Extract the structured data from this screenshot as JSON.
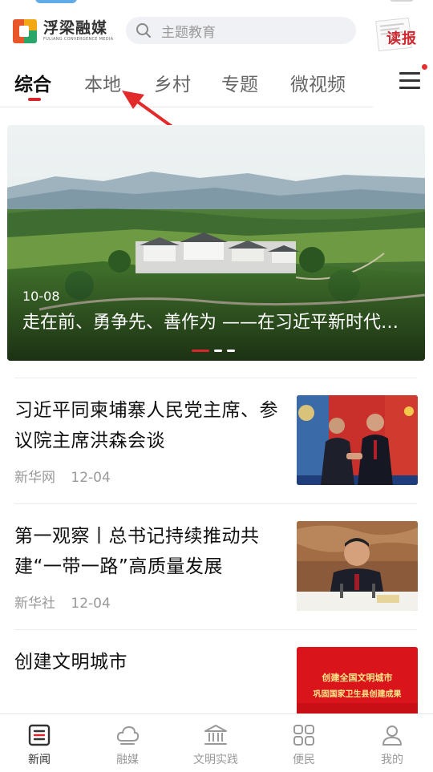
{
  "header": {
    "logo_cn": "浮梁融媒",
    "logo_en": "FULIANG CONVERGENCE MEDIA",
    "search_placeholder": "主题教育",
    "read_paper_label": "读报"
  },
  "tabs": [
    {
      "label": "综合",
      "active": true
    },
    {
      "label": "本地"
    },
    {
      "label": "乡村"
    },
    {
      "label": "专题"
    },
    {
      "label": "微视频"
    }
  ],
  "carousel": {
    "date": "10-08",
    "title": "走在前、勇争先、善作为 ——在习近平新时代中国特色社会主义思想指引下",
    "slide_count": 3,
    "active_slide": 1
  },
  "news": [
    {
      "title": "习近平同柬埔寨人民党主席、参议院主席洪森会谈",
      "source": "新华网",
      "date": "12-04"
    },
    {
      "title": "第一观察丨总书记持续推动共建“一带一路”高质量发展",
      "source": "新华社",
      "date": "12-04"
    },
    {
      "title": "创建文明城市",
      "thumb_line1": "创建全国文明城市",
      "thumb_line2": "巩固国家卫生县创建成果"
    }
  ],
  "bottom_nav": [
    {
      "label": "新闻",
      "icon": "news-icon",
      "active": true
    },
    {
      "label": "融媒",
      "icon": "cloud-icon"
    },
    {
      "label": "文明实践",
      "icon": "building-icon"
    },
    {
      "label": "便民",
      "icon": "grid-icon"
    },
    {
      "label": "我的",
      "icon": "user-icon"
    }
  ],
  "colors": {
    "accent": "#d7262e",
    "text": "#111111",
    "muted": "#999999"
  }
}
